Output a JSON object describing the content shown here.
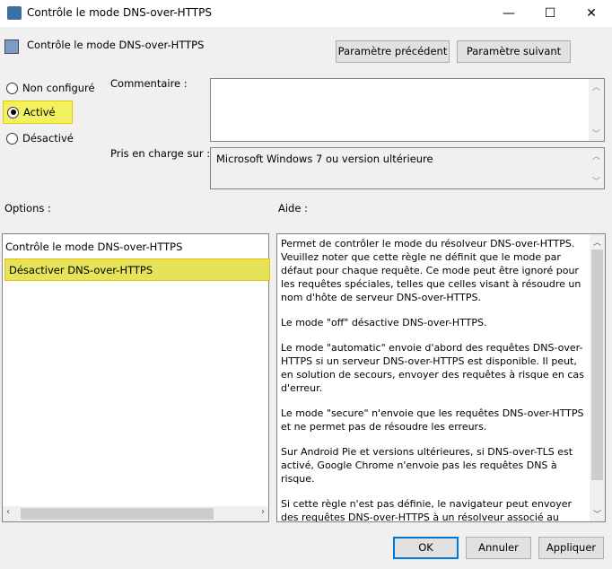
{
  "window": {
    "title": "Contrôle le mode DNS-over-HTTPS",
    "minimize": "—",
    "maximize": "☐",
    "close": "✕"
  },
  "header": {
    "policy_name": "Contrôle le mode DNS-over-HTTPS",
    "prev_button": "Paramètre précédent",
    "next_button": "Paramètre suivant"
  },
  "state": {
    "options": [
      {
        "label": "Non configuré",
        "selected": false
      },
      {
        "label": "Activé",
        "selected": true
      },
      {
        "label": "Désactivé",
        "selected": false
      }
    ]
  },
  "comment": {
    "label": "Commentaire :",
    "value": ""
  },
  "supported": {
    "label": "Pris en charge sur :",
    "value": "Microsoft Windows 7 ou version ultérieure"
  },
  "options_panel": {
    "label": "Options :",
    "title": "Contrôle le mode DNS-over-HTTPS",
    "dropdown_value": "Désactiver DNS-over-HTTPS"
  },
  "help_panel": {
    "label": "Aide :",
    "paragraphs": [
      "Permet de contrôler le mode du résolveur DNS-over-HTTPS. Veuillez noter que cette règle ne définit que le mode par défaut pour chaque requête. Ce mode peut être ignoré pour les requêtes spéciales, telles que celles visant à résoudre un nom d'hôte de serveur DNS-over-HTTPS.",
      "Le mode \"off\" désactive DNS-over-HTTPS.",
      "Le mode \"automatic\" envoie d'abord des requêtes DNS-over-HTTPS si un serveur DNS-over-HTTPS est disponible. Il peut, en solution de secours, envoyer des requêtes à risque en cas d'erreur.",
      "Le mode \"secure\" n'envoie que les requêtes DNS-over-HTTPS et ne permet pas de résoudre les erreurs.",
      "Sur Android Pie et versions ultérieures, si DNS-over-TLS est activé, Google Chrome n'envoie pas les requêtes DNS à risque.",
      "Si cette règle n'est pas définie, le navigateur peut envoyer des requêtes DNS-over-HTTPS à un résolveur associé au résolveur"
    ]
  },
  "footer": {
    "ok": "OK",
    "cancel": "Annuler",
    "apply": "Appliquer"
  },
  "colors": {
    "highlight": "#e4e35a",
    "focus": "#0078d7"
  }
}
